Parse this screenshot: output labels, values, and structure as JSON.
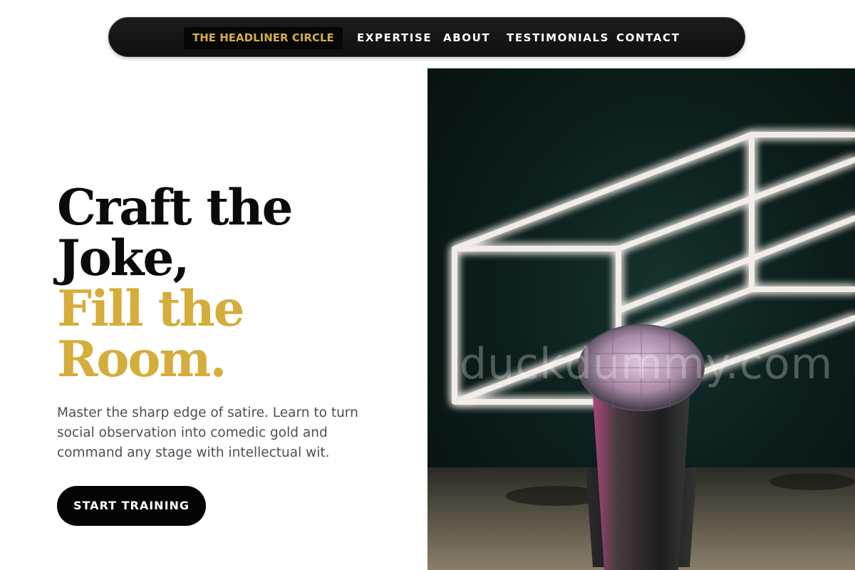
{
  "nav": {
    "brand": "THE HEADLINER CIRCLE",
    "links": [
      "EXPERTISE",
      "ABOUT",
      "TESTIMONIALS",
      "CONTACT"
    ]
  },
  "hero": {
    "headline_lines": [
      "Craft the",
      "Joke,"
    ],
    "headline_accent_lines": [
      "Fill the",
      "Room."
    ],
    "subtext": "Master the sharp edge of satire. Learn to turn social observation into comedic gold and command any stage with intellectual wit.",
    "cta_label": "START TRAINING",
    "image_watermark": "duckdummy.com"
  },
  "colors": {
    "accent_gold": "#d4ad3a",
    "nav_background": "#151515",
    "cta_background": "#050505",
    "text_body": "#4a4f57"
  }
}
